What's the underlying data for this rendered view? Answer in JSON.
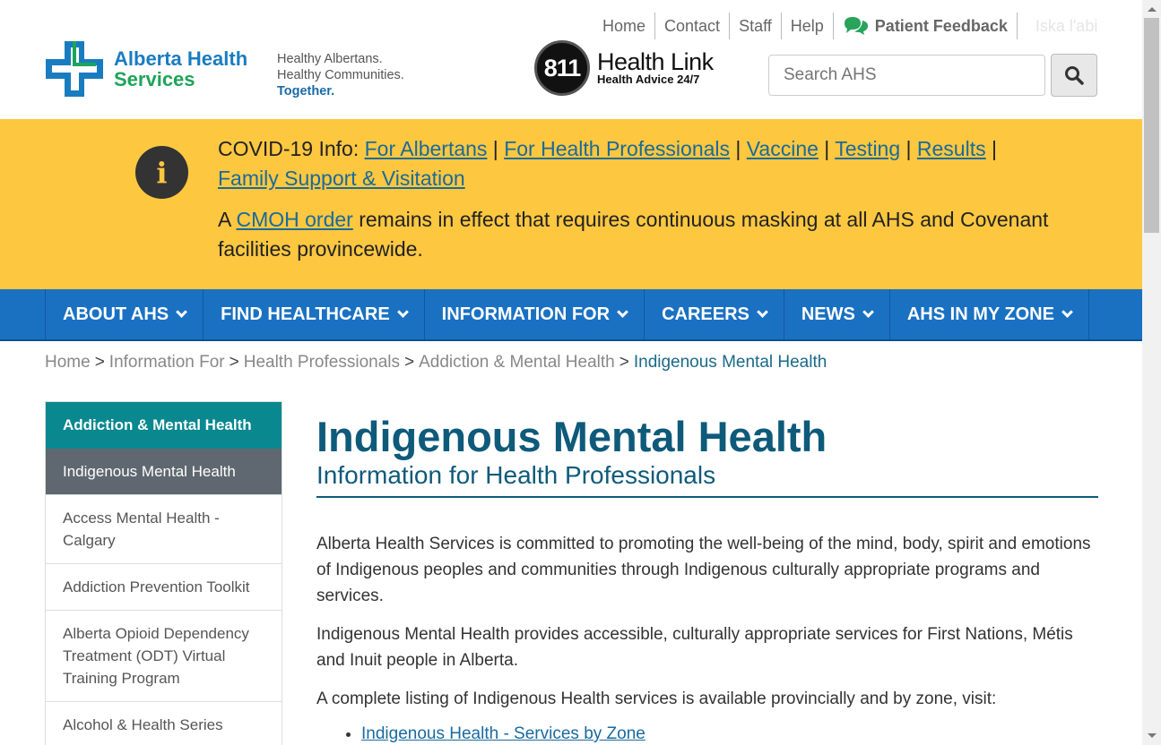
{
  "top_links": {
    "home": "Home",
    "contact": "Contact",
    "staff": "Staff",
    "help": "Help",
    "feedback": "Patient Feedback",
    "language": "Iska l'abi"
  },
  "logo": {
    "line1": "Alberta Health",
    "line2": "Services"
  },
  "tagline": {
    "line1": "Healthy Albertans.",
    "line2": "Healthy Communities.",
    "line3": "Together."
  },
  "health_link": {
    "number": "811",
    "title": "Health Link",
    "subtitle": "Health Advice 24/7"
  },
  "search": {
    "placeholder": "Search AHS",
    "button_icon": "search-icon"
  },
  "banner": {
    "prefix": "COVID-19 Info: ",
    "links": [
      "For Albertans",
      "For Health Professionals",
      "Vaccine",
      "Testing",
      "Results",
      "Family Support & Visitation"
    ],
    "separator": " | ",
    "notice_prefix": "A ",
    "notice_link": "CMOH order",
    "notice_suffix": " remains in effect that requires continuous masking at all AHS and Covenant facilities provincewide."
  },
  "nav": {
    "items": [
      "ABOUT AHS",
      "FIND HEALTHCARE",
      "INFORMATION FOR",
      "CAREERS",
      "NEWS",
      "AHS IN MY ZONE"
    ]
  },
  "breadcrumb": {
    "items": [
      "Home",
      "Information For",
      "Health Professionals",
      "Addiction & Mental Health"
    ],
    "separator": ">",
    "current": "Indigenous Mental Health"
  },
  "sidebar": {
    "heading": "Addiction & Mental Health",
    "active": "Indigenous Mental Health",
    "items": [
      "Access Mental Health - Calgary",
      "Addiction Prevention Toolkit",
      "Alberta Opioid Dependency Treatment (ODT) Virtual Training Program",
      "Alcohol & Health Series"
    ]
  },
  "main": {
    "title": "Indigenous Mental Health",
    "subtitle": "Information for Health Professionals",
    "paragraphs": [
      "Alberta Health Services is committed to promoting the well-being of the mind, body, spirit and emotions of Indigenous peoples and communities through Indigenous culturally appropriate programs and services.",
      "Indigenous Mental Health provides accessible, culturally appropriate services for First Nations, Métis and Inuit people in Alberta.",
      "A complete listing of Indigenous Health services is available provincially and by zone, visit:"
    ],
    "list_links": [
      "Indigenous Health - Services by Zone"
    ]
  },
  "colors": {
    "banner": "#fdc740",
    "nav": "#1a71c2",
    "sidebar_heading": "#0a8890",
    "sidebar_active": "#5f6870",
    "title": "#0e5a7a",
    "link": "#1a6a9a"
  }
}
